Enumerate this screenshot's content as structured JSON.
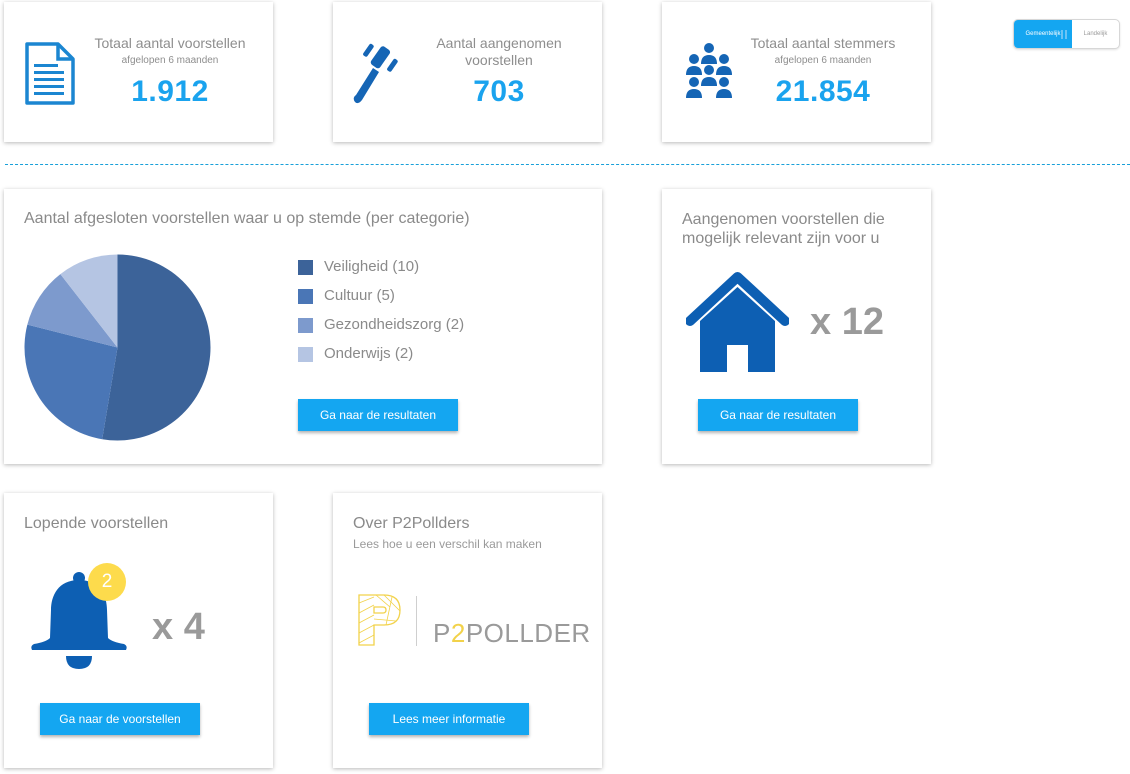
{
  "stats": [
    {
      "title": "Totaal aantal voorstellen",
      "subtitle": "afgelopen 6 maanden",
      "value": "1.912",
      "icon": "document-icon"
    },
    {
      "title_line1": "Aantal aangenomen",
      "title_line2": "voorstellen",
      "value": "703",
      "icon": "gavel-icon"
    },
    {
      "title": "Totaal aantal stemmers",
      "subtitle": "afgelopen 6 maanden",
      "value": "21.854",
      "icon": "group-icon"
    }
  ],
  "toggle": {
    "active": "Gemeentelijk",
    "inactive": "Landelijk"
  },
  "category_card": {
    "title": "Aantal afgesloten voorstellen waar u op stemde (per categorie)",
    "button": "Ga naar de resultaten"
  },
  "chart_data": {
    "type": "pie",
    "categories": [
      "Veiligheid",
      "Cultuur",
      "Gezondheidszorg",
      "Onderwijs"
    ],
    "values": [
      10,
      5,
      2,
      2
    ],
    "legend": [
      "Veiligheid (10)",
      "Cultuur (5)",
      "Gezondheidszorg (2)",
      "Onderwijs (2)"
    ],
    "colors": [
      "#3c6399",
      "#4a76b6",
      "#7d9acd",
      "#b5c5e3"
    ],
    "legend_position": "right"
  },
  "relevant_card": {
    "title_line1": "Aangenomen voorstellen die",
    "title_line2": "mogelijk relevant zijn voor u",
    "multiplier": "x 12",
    "icon": "house-icon",
    "button": "Ga naar de resultaten"
  },
  "running_card": {
    "title": "Lopende voorstellen",
    "badge": "2",
    "multiplier": "x 4",
    "icon": "bell-icon",
    "button": "Ga naar de voorstellen"
  },
  "about_card": {
    "title": "Over P2Pollders",
    "subtitle": "Lees hoe u een verschil kan maken",
    "logo_prefix": "P",
    "logo_accent": "2",
    "logo_suffix": "POLLDER",
    "button": "Lees meer informatie"
  },
  "colors": {
    "accent": "#14a6f1",
    "icon_blue": "#1565b5",
    "badge_yellow": "#fddb4c",
    "logo_yellow": "#f2d24a"
  }
}
